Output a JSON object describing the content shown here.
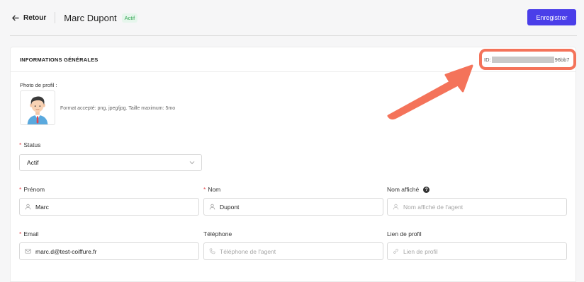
{
  "topbar": {
    "back_label": "Retour",
    "agent_name": "Marc Dupont",
    "status_badge": "Actif",
    "save_label": "Enregistrer"
  },
  "card": {
    "title": "INFORMATIONS GÉNÉRALES",
    "id_label": "ID:",
    "id_tail": "96bb7"
  },
  "photo": {
    "label": "Photo de profil :",
    "hint": "Format accepté: png, jpeg/jpg. Taille maximum: 5mo"
  },
  "status": {
    "label": "Status",
    "value": "Actif"
  },
  "fields": {
    "prenom": {
      "label": "Prénom",
      "value": "Marc",
      "placeholder": ""
    },
    "nom": {
      "label": "Nom",
      "value": "Dupont",
      "placeholder": ""
    },
    "nom_affiche": {
      "label": "Nom affiché",
      "value": "",
      "placeholder": "Nom affiché de l'agent"
    },
    "email": {
      "label": "Email",
      "value": "marc.d@test-coiffure.fr",
      "placeholder": ""
    },
    "telephone": {
      "label": "Téléphone",
      "value": "",
      "placeholder": "Téléphone de l'agent"
    },
    "lien_profil": {
      "label": "Lien de profil",
      "value": "",
      "placeholder": "Lien de profil"
    }
  },
  "icons": {
    "back": "arrow-left-icon",
    "chevron": "chevron-down-icon",
    "user": "user-icon",
    "mail": "mail-icon",
    "phone": "phone-icon",
    "link": "link-icon",
    "help": "question-icon"
  },
  "colors": {
    "primary": "#4a3ee9",
    "badge_bg": "#e6f6ec",
    "badge_text": "#2ea44f",
    "required": "#e5484d",
    "annotation": "#f4735a"
  }
}
